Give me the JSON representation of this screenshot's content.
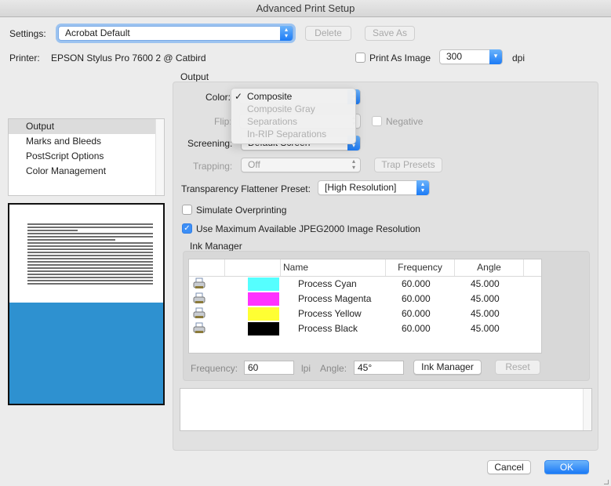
{
  "window": {
    "title": "Advanced Print Setup"
  },
  "settings": {
    "label": "Settings:",
    "value": "Acrobat Default",
    "delete_label": "Delete",
    "save_as_label": "Save As"
  },
  "printer": {
    "label": "Printer:",
    "value": "EPSON Stylus Pro 7600 2 @ Catbird",
    "print_as_image_label": "Print As Image",
    "print_as_image_checked": false,
    "dpi_value": "300",
    "dpi_unit": "dpi"
  },
  "sidebar": {
    "items": [
      {
        "label": "Output",
        "selected": true
      },
      {
        "label": "Marks and Bleeds",
        "selected": false
      },
      {
        "label": "PostScript Options",
        "selected": false
      },
      {
        "label": "Color Management",
        "selected": false
      }
    ]
  },
  "preview": {
    "accent_color": "#2e91d0"
  },
  "output": {
    "section_title": "Output",
    "color_label": "Color:",
    "color_menu": {
      "options": [
        {
          "label": "Composite",
          "checked": true,
          "enabled": true
        },
        {
          "label": "Composite Gray",
          "checked": false,
          "enabled": false
        },
        {
          "label": "Separations",
          "checked": false,
          "enabled": false
        },
        {
          "label": "In-RIP Separations",
          "checked": false,
          "enabled": false
        }
      ]
    },
    "flip_label": "Flip:",
    "negative_label": "Negative",
    "negative_checked": false,
    "screening_label": "Screening:",
    "screening_value": "Default Screen",
    "trapping_label": "Trapping:",
    "trapping_value": "Off",
    "trap_presets_label": "Trap Presets",
    "flattener_label": "Transparency Flattener Preset:",
    "flattener_value": "[High Resolution]",
    "simulate_overprinting_label": "Simulate Overprinting",
    "simulate_overprinting_checked": false,
    "jpeg2000_label": "Use Maximum Available JPEG2000 Image Resolution",
    "jpeg2000_checked": true
  },
  "ink_manager": {
    "title": "Ink Manager",
    "columns": [
      "",
      "",
      "Name",
      "Frequency",
      "Angle"
    ],
    "rows": [
      {
        "icon": "printer-icon",
        "swatch": "#55ffff",
        "name": "Process Cyan",
        "frequency": "60.000",
        "angle": "45.000"
      },
      {
        "icon": "printer-icon",
        "swatch": "#ff33ff",
        "name": "Process Magenta",
        "frequency": "60.000",
        "angle": "45.000"
      },
      {
        "icon": "printer-icon",
        "swatch": "#ffff33",
        "name": "Process Yellow",
        "frequency": "60.000",
        "angle": "45.000"
      },
      {
        "icon": "printer-icon",
        "swatch": "#000000",
        "name": "Process Black",
        "frequency": "60.000",
        "angle": "45.000"
      }
    ],
    "frequency_label": "Frequency:",
    "frequency_value": "60",
    "frequency_unit": "lpi",
    "angle_label": "Angle:",
    "angle_value": "45°",
    "ink_manager_button": "Ink Manager",
    "reset_button": "Reset"
  },
  "footer": {
    "cancel_label": "Cancel",
    "ok_label": "OK"
  }
}
